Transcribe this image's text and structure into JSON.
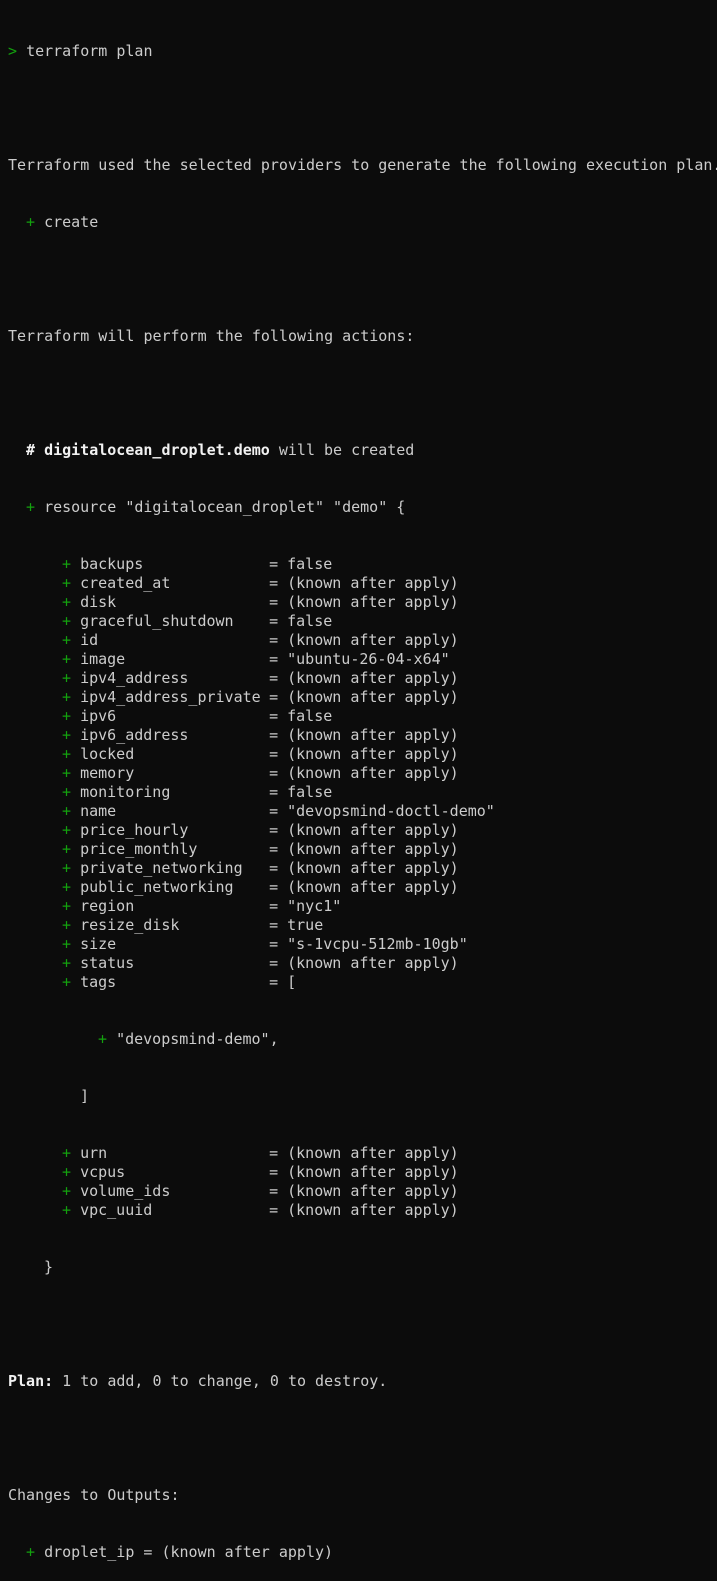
{
  "colors": {
    "background": "#0c0c0c",
    "text": "#cccccc",
    "plus": "#13a10e",
    "bold": "#f2f2f2"
  },
  "prompt": {
    "symbol": ">",
    "command": "terraform plan"
  },
  "intro": {
    "line1": "Terraform used the selected providers to generate the following execution plan.",
    "symbol_line": "create",
    "actions_line": "Terraform will perform the following actions:"
  },
  "resource": {
    "comment_hash": "#",
    "comment_name": "digitalocean_droplet.demo",
    "comment_suffix": " will be created",
    "header": "resource \"digitalocean_droplet\" \"demo\" {",
    "attributes": [
      {
        "key": "backups",
        "value": "false"
      },
      {
        "key": "created_at",
        "value": "(known after apply)"
      },
      {
        "key": "disk",
        "value": "(known after apply)"
      },
      {
        "key": "graceful_shutdown",
        "value": "false"
      },
      {
        "key": "id",
        "value": "(known after apply)"
      },
      {
        "key": "image",
        "value": "\"ubuntu-26-04-x64\""
      },
      {
        "key": "ipv4_address",
        "value": "(known after apply)"
      },
      {
        "key": "ipv4_address_private",
        "value": "(known after apply)"
      },
      {
        "key": "ipv6",
        "value": "false"
      },
      {
        "key": "ipv6_address",
        "value": "(known after apply)"
      },
      {
        "key": "locked",
        "value": "(known after apply)"
      },
      {
        "key": "memory",
        "value": "(known after apply)"
      },
      {
        "key": "monitoring",
        "value": "false"
      },
      {
        "key": "name",
        "value": "\"devopsmind-doctl-demo\""
      },
      {
        "key": "price_hourly",
        "value": "(known after apply)"
      },
      {
        "key": "price_monthly",
        "value": "(known after apply)"
      },
      {
        "key": "private_networking",
        "value": "(known after apply)"
      },
      {
        "key": "public_networking",
        "value": "(known after apply)"
      },
      {
        "key": "region",
        "value": "\"nyc1\""
      },
      {
        "key": "resize_disk",
        "value": "true"
      },
      {
        "key": "size",
        "value": "\"s-1vcpu-512mb-10gb\""
      },
      {
        "key": "status",
        "value": "(known after apply)"
      },
      {
        "key": "tags",
        "value": "["
      }
    ],
    "tag_item": "\"devopsmind-demo\",",
    "tags_close": "]",
    "attributes_after": [
      {
        "key": "urn",
        "value": "(known after apply)"
      },
      {
        "key": "vcpus",
        "value": "(known after apply)"
      },
      {
        "key": "volume_ids",
        "value": "(known after apply)"
      },
      {
        "key": "vpc_uuid",
        "value": "(known after apply)"
      }
    ],
    "close_brace": "}"
  },
  "plan": {
    "label": "Plan:",
    "summary": " 1 to add, 0 to change, 0 to destroy."
  },
  "outputs": {
    "header": "Changes to Outputs:",
    "line": "droplet_ip = (known after apply)"
  }
}
